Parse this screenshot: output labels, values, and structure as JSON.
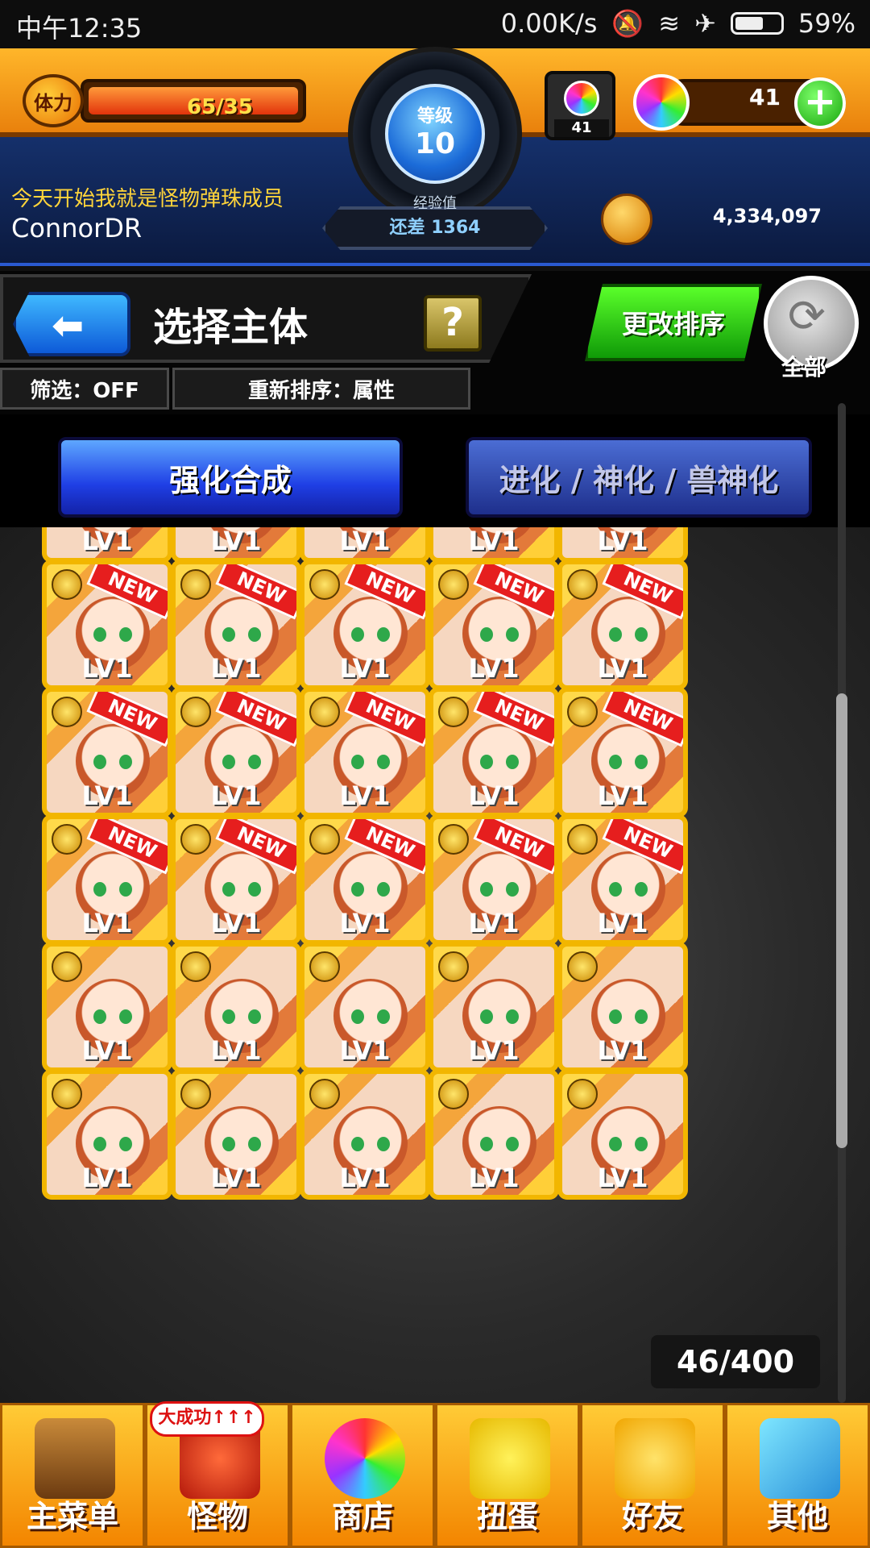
{
  "status_bar": {
    "time": "中午12:35",
    "speed": "0.00K/s",
    "battery": "59%",
    "icons": [
      "bell-muted-icon",
      "wifi-icon",
      "airplane-icon",
      "battery-icon"
    ]
  },
  "hud": {
    "stamina_label": "体力",
    "stamina_current": "65",
    "stamina_max": "35",
    "stamina_text": "65/35",
    "stamina_fill_fraction": 1.0,
    "level_label": "等级",
    "level_value": "10",
    "exp_label": "经验值",
    "exp_text": "还差 1364",
    "orb_box_count": "41",
    "orb_count": "41",
    "subtitle": "今天开始我就是怪物弹珠成员",
    "username": "ConnorDR",
    "coins": "4,334,097"
  },
  "header": {
    "title": "选择主体",
    "help": "?",
    "filter": "筛选：OFF",
    "sort_info": "重新排序：属性",
    "sort_button": "更改排序",
    "all_label": "全部"
  },
  "modes": {
    "active": "强化合成",
    "inactive": "进化 / 神化 / 兽神化"
  },
  "grid": {
    "level_label": "LV1",
    "new_tag": "NEW",
    "rows": [
      {
        "new": [
          false,
          false,
          false,
          false,
          false
        ]
      },
      {
        "new": [
          true,
          true,
          true,
          true,
          true
        ]
      },
      {
        "new": [
          true,
          true,
          true,
          true,
          true
        ]
      },
      {
        "new": [
          true,
          true,
          true,
          true,
          true
        ]
      },
      {
        "new": [
          false,
          false,
          false,
          false,
          false
        ]
      },
      {
        "new": [
          false,
          false,
          false,
          false,
          false
        ]
      }
    ],
    "count": "46/400"
  },
  "nav": {
    "badge": "大成功↑↑↑",
    "items": [
      "主菜单",
      "怪物",
      "商店",
      "扭蛋",
      "好友",
      "其他"
    ]
  },
  "colors": {
    "accent_orange": "#f28a10",
    "hud_blue": "#122a5c",
    "active_mode": "#1f3fe5",
    "sort_green": "#0f9a07"
  }
}
